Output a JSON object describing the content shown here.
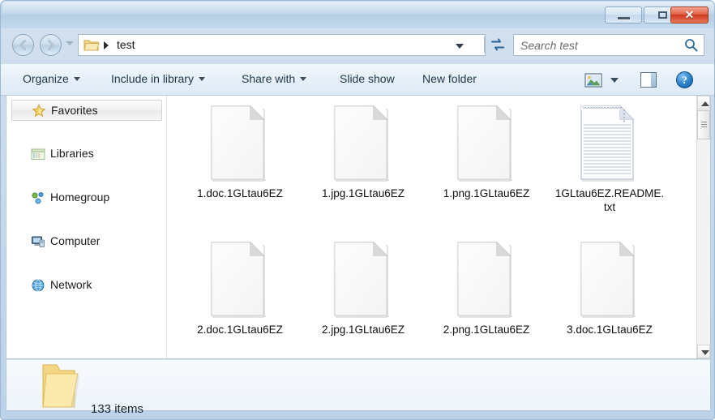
{
  "window": {
    "controls": {
      "minimize_label": "Minimize",
      "maximize_label": "Maximize",
      "close_label": "Close",
      "close_glyph": "✕",
      "close_color": "#cf3a1c"
    }
  },
  "navigation": {
    "back_label": "Back",
    "forward_label": "Forward",
    "recent_pages_label": "Recent pages",
    "refresh_label": "Refresh"
  },
  "address": {
    "path": "test",
    "chevron": "▸",
    "dropdown_label": "Previous locations"
  },
  "search": {
    "placeholder": "Search test",
    "value": ""
  },
  "toolbar": {
    "organize_label": "Organize",
    "include_label": "Include in library",
    "share_label": "Share with",
    "slideshow_label": "Slide show",
    "newfolder_label": "New folder",
    "view_label": "Change your view",
    "preview_label": "Show the preview pane",
    "help_label": "Get help",
    "help_glyph": "?"
  },
  "sidebar": {
    "items": [
      {
        "label": "Favorites",
        "icon": "star-icon",
        "selected": true
      },
      {
        "label": "Libraries",
        "icon": "libraries-icon",
        "selected": false
      },
      {
        "label": "Homegroup",
        "icon": "homegroup-icon",
        "selected": false
      },
      {
        "label": "Computer",
        "icon": "computer-icon",
        "selected": false
      },
      {
        "label": "Network",
        "icon": "network-icon",
        "selected": false
      }
    ]
  },
  "files": [
    {
      "name": "1.doc.1GLtau6EZ",
      "icon": "blank-file-icon"
    },
    {
      "name": "1.jpg.1GLtau6EZ",
      "icon": "blank-file-icon"
    },
    {
      "name": "1.png.1GLtau6EZ",
      "icon": "blank-file-icon"
    },
    {
      "name": "1GLtau6EZ.README.txt",
      "icon": "text-file-icon"
    },
    {
      "name": "2.doc.1GLtau6EZ",
      "icon": "blank-file-icon"
    },
    {
      "name": "2.jpg.1GLtau6EZ",
      "icon": "blank-file-icon"
    },
    {
      "name": "2.png.1GLtau6EZ",
      "icon": "blank-file-icon"
    },
    {
      "name": "3.doc.1GLtau6EZ",
      "icon": "blank-file-icon"
    }
  ],
  "scrollbar": {
    "up_label": "Scroll up",
    "down_label": "Scroll down",
    "thumb_label": "Scroll thumb"
  },
  "status": {
    "item_count_text": "133 items",
    "folder_icon": "folder-icon"
  }
}
